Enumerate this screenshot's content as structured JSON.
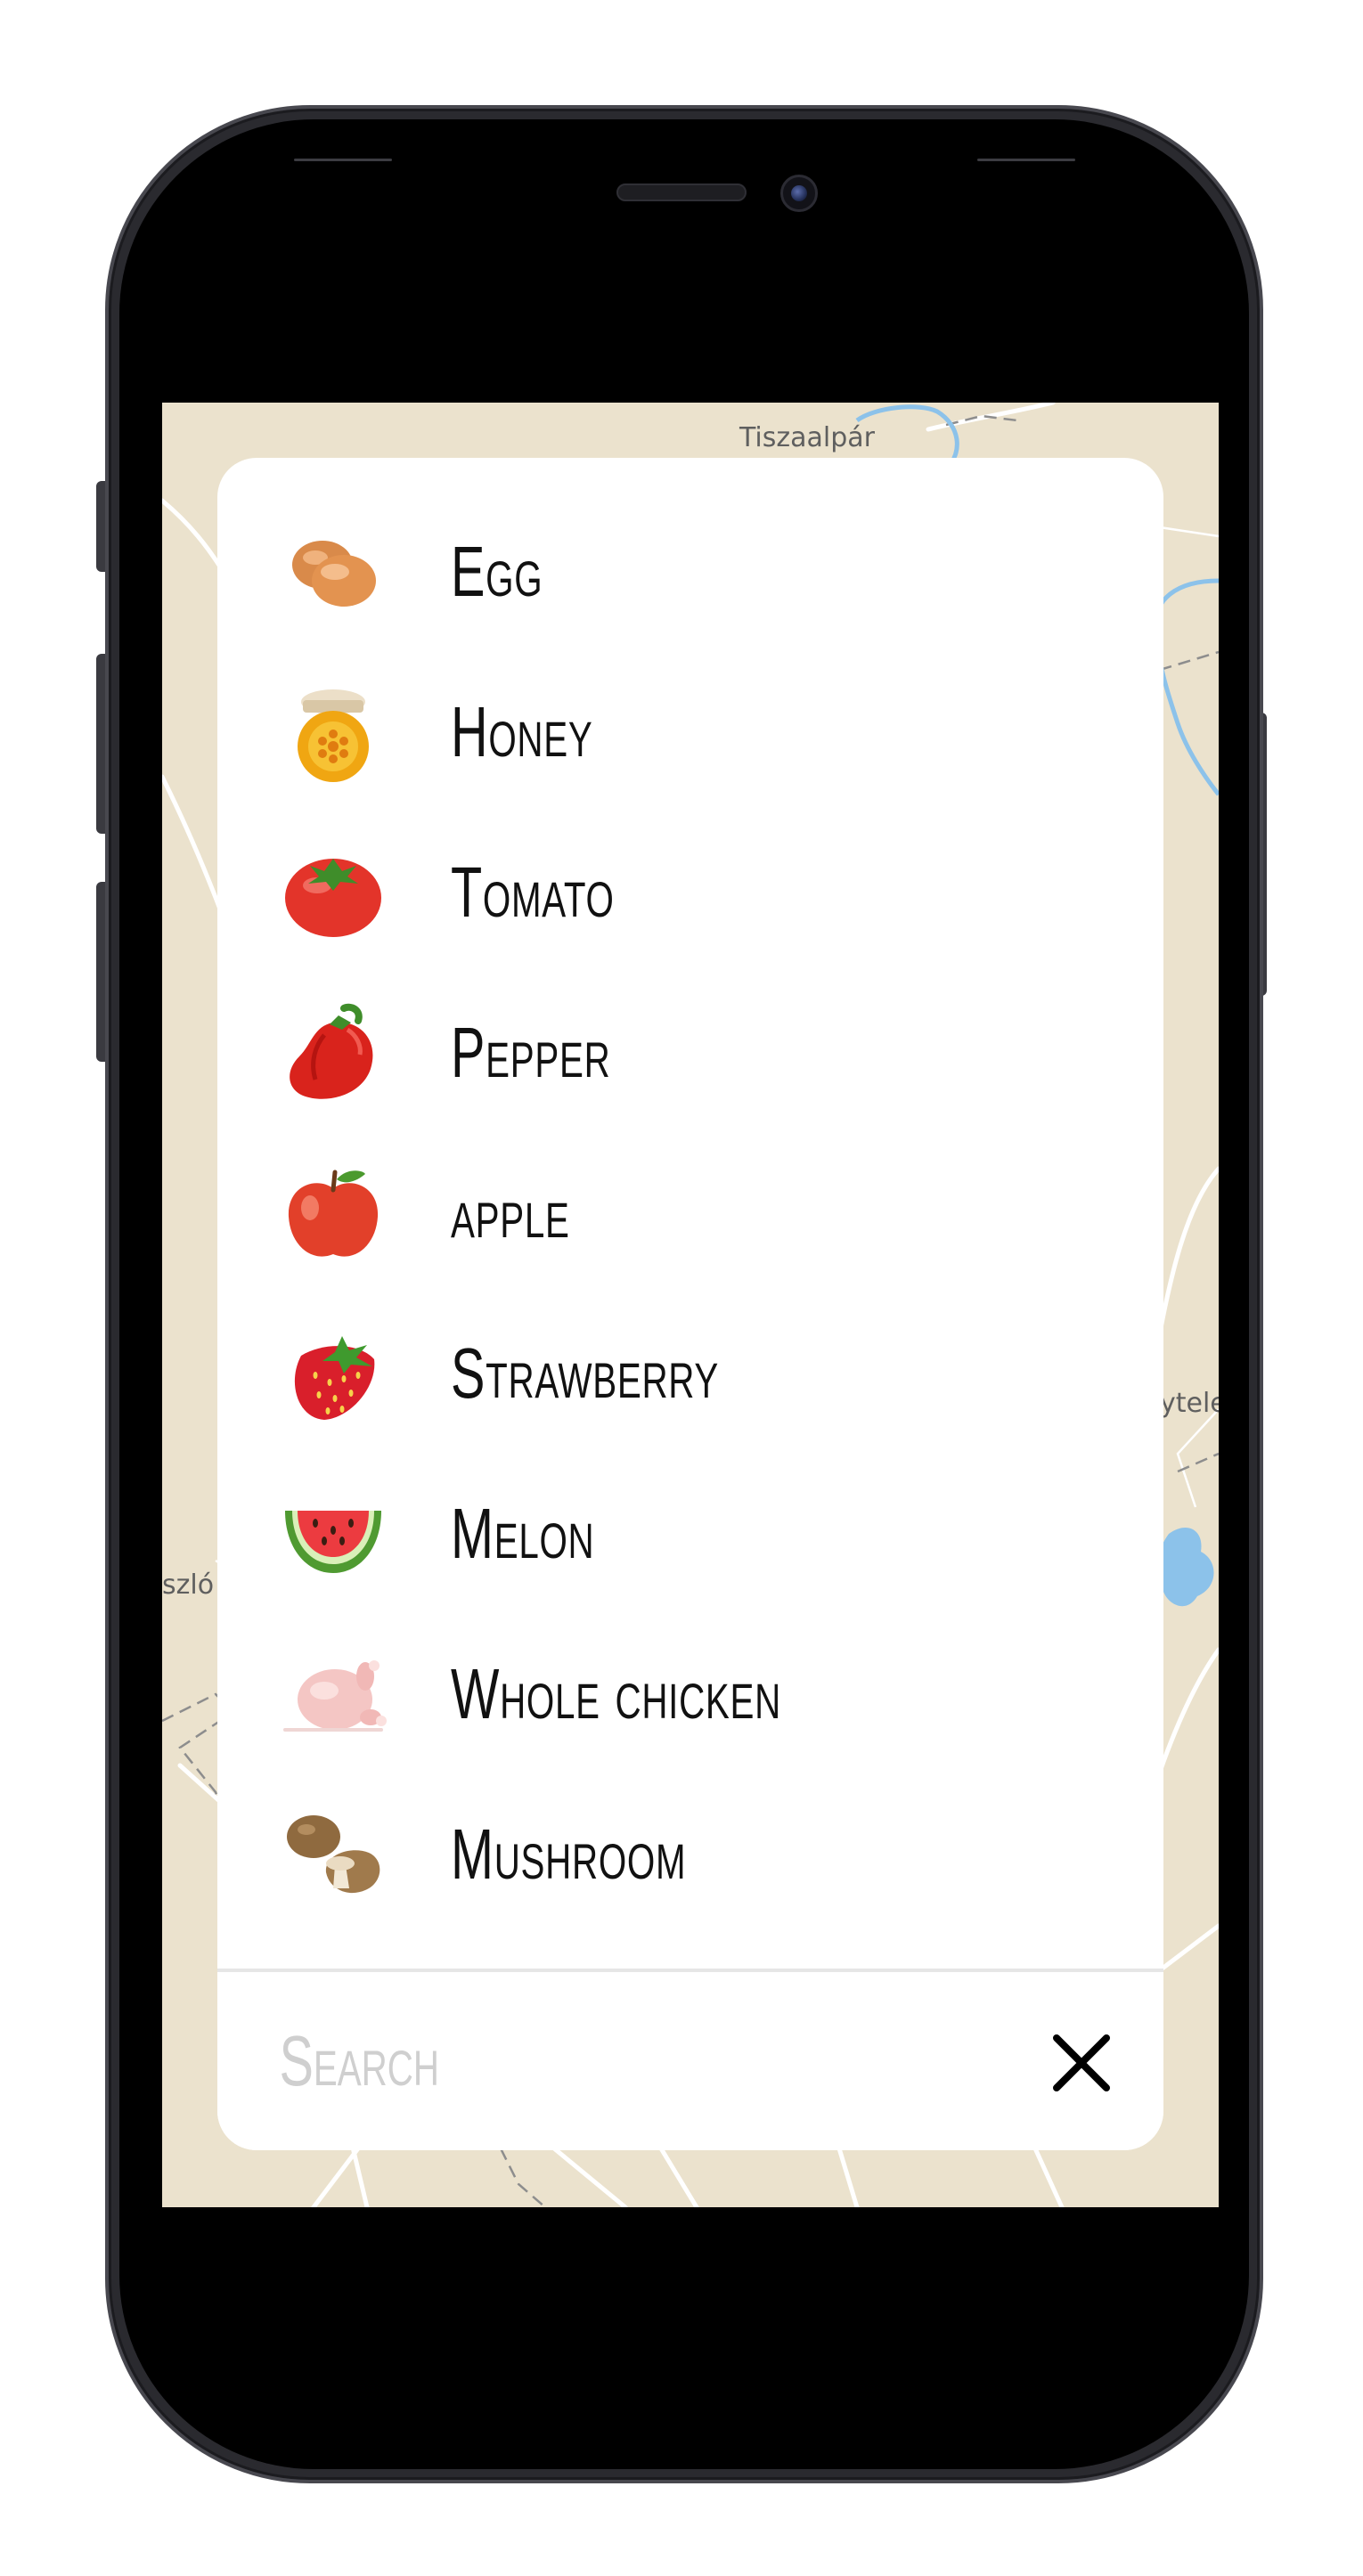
{
  "map": {
    "labels": {
      "top": "Tiszaalpár",
      "right": "ytele",
      "left": "szló"
    },
    "colors": {
      "land": "#ebe2cd",
      "road": "#ffffff",
      "water": "#8cc2ea"
    }
  },
  "food_picker": {
    "items": [
      {
        "label": "Egg",
        "icon": "egg-icon"
      },
      {
        "label": "Honey",
        "icon": "honey-jar-icon"
      },
      {
        "label": "Tomato",
        "icon": "tomato-icon"
      },
      {
        "label": "Pepper",
        "icon": "pepper-icon"
      },
      {
        "label": "apple",
        "icon": "apple-icon"
      },
      {
        "label": "Strawberry",
        "icon": "strawberry-icon"
      },
      {
        "label": "Melon",
        "icon": "watermelon-icon"
      },
      {
        "label": "Whole chicken",
        "icon": "whole-chicken-icon"
      },
      {
        "label": "Mushroom",
        "icon": "mushroom-icon"
      }
    ],
    "search": {
      "placeholder": "Search",
      "value": "",
      "clear_icon": "close-icon"
    }
  }
}
